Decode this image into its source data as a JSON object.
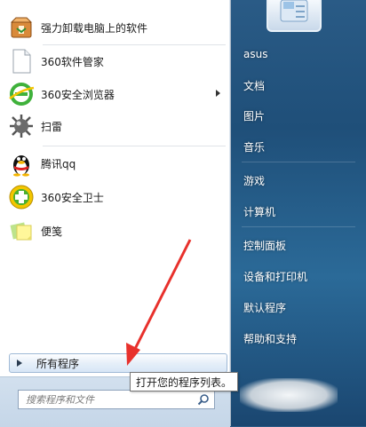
{
  "programs": [
    {
      "label": "强力卸载电脑上的软件",
      "icon": "uninstall-box-icon"
    },
    {
      "label": "360软件管家",
      "icon": "blank-document-icon"
    },
    {
      "label": "360安全浏览器",
      "icon": "browser-e-icon"
    },
    {
      "label": "扫雷",
      "icon": "minesweeper-icon"
    },
    {
      "label": "腾讯qq",
      "icon": "qq-penguin-icon"
    },
    {
      "label": "360安全卫士",
      "icon": "360-guard-icon"
    },
    {
      "label": "便笺",
      "icon": "sticky-notes-icon"
    }
  ],
  "all_programs": {
    "label": "所有程序"
  },
  "tooltip": {
    "text": "打开您的程序列表。"
  },
  "search": {
    "placeholder": "搜索程序和文件"
  },
  "right_menu": [
    {
      "label": "asus"
    },
    {
      "label": "文档"
    },
    {
      "label": "图片"
    },
    {
      "label": "音乐"
    },
    {
      "label": "游戏"
    },
    {
      "label": "计算机"
    },
    {
      "label": "控制面板"
    },
    {
      "label": "设备和打印机"
    },
    {
      "label": "默认程序"
    },
    {
      "label": "帮助和支持"
    }
  ],
  "colors": {
    "annotation": "#e8312c",
    "right_pane": "#2a5b86"
  }
}
